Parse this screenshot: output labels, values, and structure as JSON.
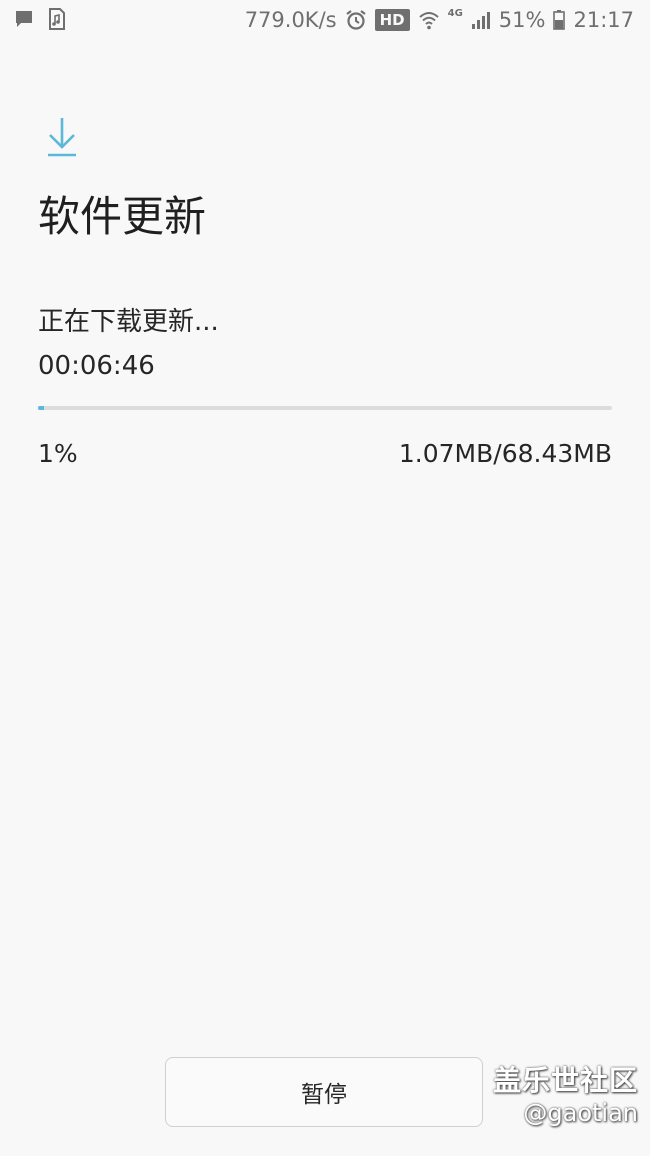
{
  "status_bar": {
    "net_speed": "779.0K/s",
    "hd_label": "HD",
    "network_type": "4G",
    "battery": "51%",
    "time": "21:17"
  },
  "header": {
    "icon": "download-icon",
    "title": "软件更新"
  },
  "download": {
    "status": "正在下载更新...",
    "elapsed": "00:06:46",
    "progress_fraction": 0.01,
    "percent_label": "1%",
    "size_label": "1.07MB/68.43MB"
  },
  "actions": {
    "pause_label": "暂停"
  },
  "watermark": {
    "line1": "盖乐世社区",
    "line2": "@gaotian"
  },
  "colors": {
    "accent": "#5bb8d6",
    "background": "#f8f8f8",
    "text": "#262626"
  }
}
